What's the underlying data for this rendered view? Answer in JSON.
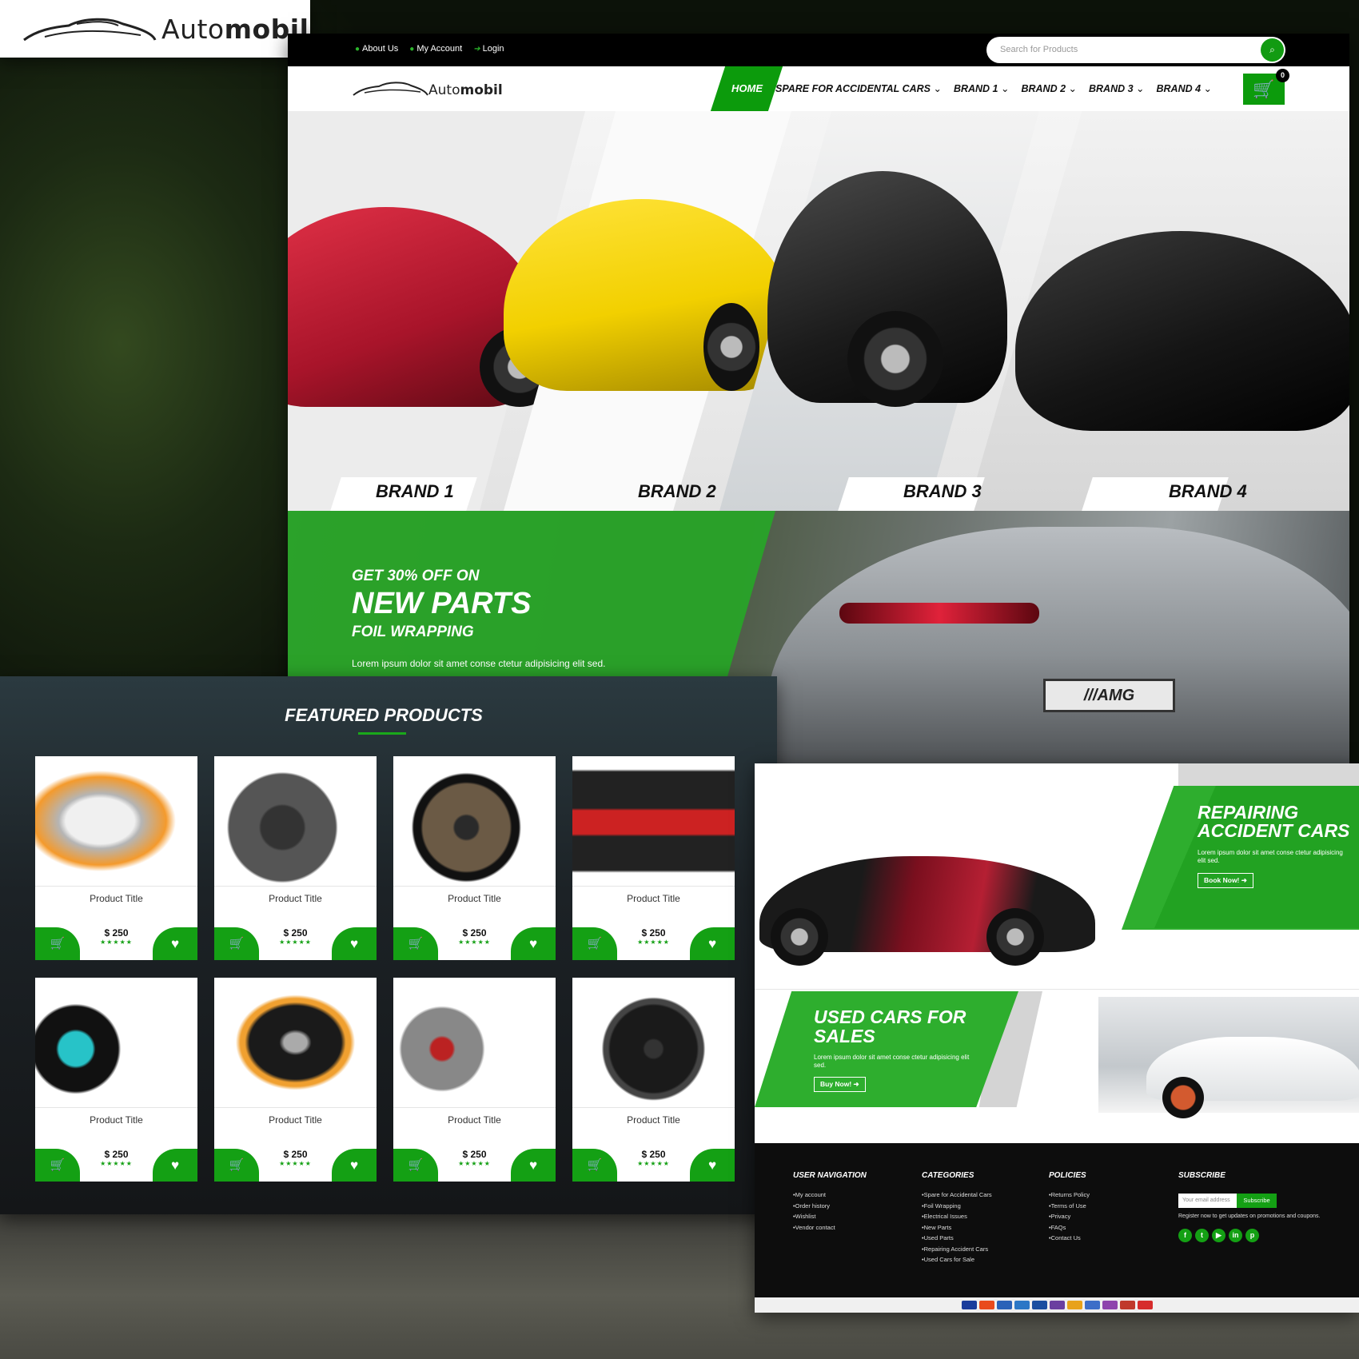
{
  "brand": {
    "name_light": "Auto",
    "name_bold": "mobil"
  },
  "topbar": {
    "links": [
      "About Us",
      "My Account",
      "Login"
    ],
    "search_placeholder": "Search for Products"
  },
  "nav": {
    "home": "HOME",
    "items": [
      "SPARE FOR ACCIDENTAL CARS",
      "BRAND 1",
      "BRAND 2",
      "BRAND 3",
      "BRAND 4"
    ],
    "cart_count": "0"
  },
  "hero": {
    "brands": [
      "BRAND 1",
      "BRAND 2",
      "BRAND 3",
      "BRAND 4"
    ]
  },
  "promo": {
    "line1": "GET 30% OFF ON",
    "line2": "NEW PARTS",
    "line3": "FOIL WRAPPING",
    "text": "Lorem ipsum dolor sit amet conse ctetur adipisicing elit sed."
  },
  "featured": {
    "heading": "FEATURED PRODUCTS",
    "products": [
      {
        "title": "Product Title",
        "price": "$ 250",
        "stars": "★★★★★",
        "icon": "headlight-pair"
      },
      {
        "title": "Product Title",
        "price": "$ 250",
        "stars": "★★★★★",
        "icon": "brake-caliper"
      },
      {
        "title": "Product Title",
        "price": "$ 250",
        "stars": "★★★★★",
        "icon": "alloy-rims"
      },
      {
        "title": "Product Title",
        "price": "$ 250",
        "stars": "★★★★★",
        "icon": "racing-seat"
      },
      {
        "title": "Product Title",
        "price": "$ 250",
        "stars": "★★★★★",
        "icon": "car-speaker-tube"
      },
      {
        "title": "Product Title",
        "price": "$ 250",
        "stars": "★★★★★",
        "icon": "projector-headlights"
      },
      {
        "title": "Product Title",
        "price": "$ 250",
        "stars": "★★★★★",
        "icon": "speaker-pair"
      },
      {
        "title": "Product Title",
        "price": "$ 250",
        "stars": "★★★★★",
        "icon": "black-rim"
      }
    ]
  },
  "repair": {
    "heading1": "REPAIRING",
    "heading2": "ACCIDENT CARS",
    "text": "Lorem ipsum dolor sit amet conse ctetur adipisicing elit sed.",
    "button": "Book Now! ➜"
  },
  "used": {
    "heading1": "USED CARS FOR",
    "heading2": "SALES",
    "text": "Lorem ipsum dolor sit amet conse ctetur adipisicing elit sed.",
    "button": "Buy Now! ➜"
  },
  "footer": {
    "user_nav": {
      "title": "USER NAVIGATION",
      "items": [
        "My account",
        "Order history",
        "Wishlist",
        "Vendor contact"
      ]
    },
    "categories": {
      "title": "CATEGORIES",
      "items": [
        "Spare for Accidental Cars",
        "Foil Wrapping",
        "Electrical Issues",
        "New Parts",
        "Used Parts",
        "Repairing Accident Cars",
        "Used Cars for Sale"
      ]
    },
    "policies": {
      "title": "POLICIES",
      "items": [
        "Returns Policy",
        "Terms of Use",
        "Privacy",
        "FAQs",
        "Contact Us"
      ]
    },
    "subscribe": {
      "title": "SUBSCRIBE",
      "placeholder": "Your email address",
      "button": "Subscribe",
      "text": "Register now to get updates on promotions and coupons.",
      "socials": [
        "f",
        "t",
        "▶",
        "in",
        "p"
      ]
    }
  },
  "colors": {
    "accent": "#14a014",
    "dark": "#000000"
  }
}
